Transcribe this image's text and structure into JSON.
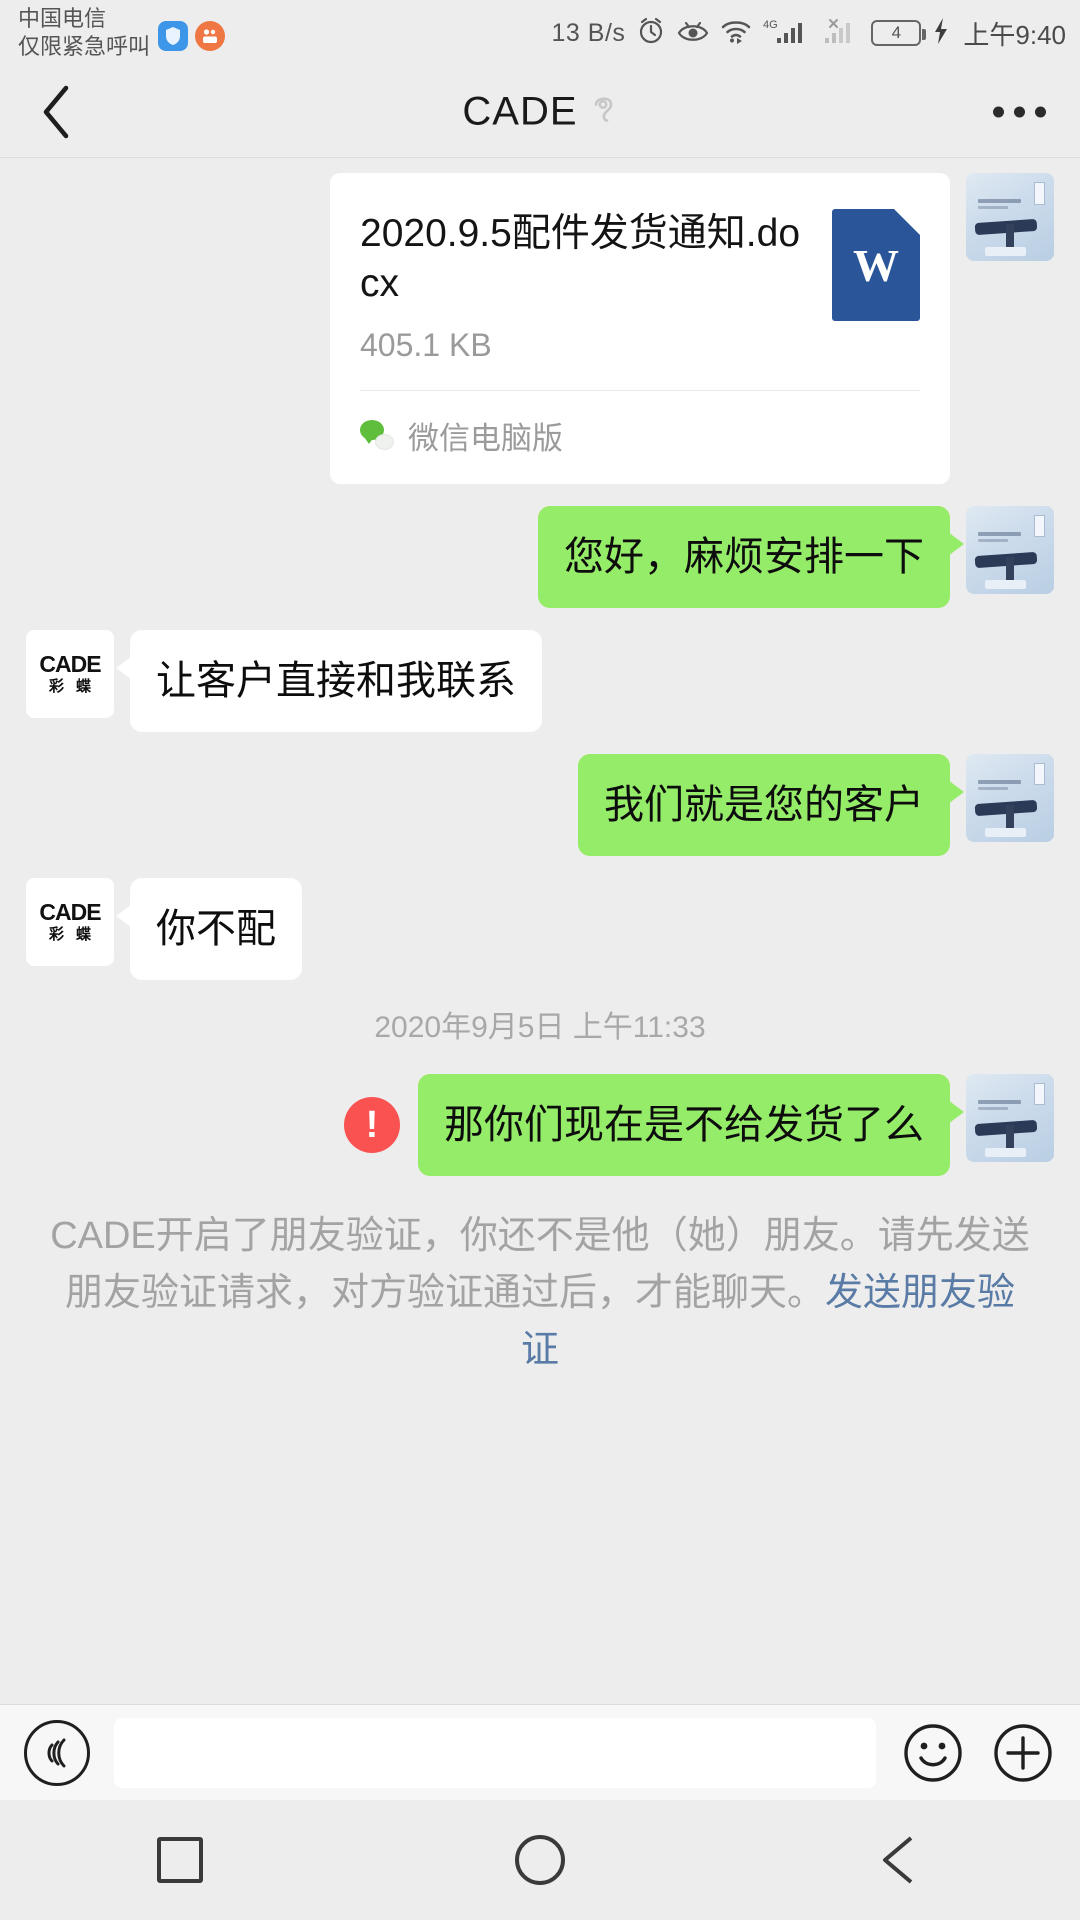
{
  "status_bar": {
    "carrier_line1": "中国电信",
    "carrier_line2": "仅限紧急呼叫",
    "network_speed": "13 B/s",
    "network_type": "4G",
    "battery_level": "4",
    "time": "上午9:40",
    "icons": [
      "shield-app-icon",
      "camera-app-icon",
      "alarm-icon",
      "eye-care-icon",
      "wifi-icon",
      "signal-4g-icon",
      "signal-no-sim-icon",
      "battery-icon",
      "charging-bolt-icon"
    ]
  },
  "nav_bar": {
    "back_icon": "chevron-left-icon",
    "title": "CADE",
    "mute_icon": "mute-ear-icon",
    "more_icon": "more-dots-icon"
  },
  "messages": [
    {
      "id": "msg-file",
      "type": "file",
      "side": "out",
      "file_name": "2020.9.5配件发货通知.docx",
      "file_size": "405.1 KB",
      "file_type_letter": "W",
      "source_app": "微信电脑版",
      "avatar": "user-product-avatar"
    },
    {
      "id": "msg-1",
      "type": "text",
      "side": "out",
      "text": "您好，麻烦安排一下",
      "avatar": "user-product-avatar"
    },
    {
      "id": "msg-2",
      "type": "text",
      "side": "in",
      "text": "让客户直接和我联系",
      "avatar": "cade-logo-avatar"
    },
    {
      "id": "msg-3",
      "type": "text",
      "side": "out",
      "text": "我们就是您的客户",
      "avatar": "user-product-avatar"
    },
    {
      "id": "msg-4",
      "type": "text",
      "side": "in",
      "text": "你不配",
      "avatar": "cade-logo-avatar"
    }
  ],
  "time_divider": "2020年9月5日 上午11:33",
  "failed_message": {
    "id": "msg-5",
    "type": "text",
    "side": "out",
    "text": "那你们现在是不给发货了么",
    "error_mark": "!",
    "avatar": "user-product-avatar"
  },
  "system_notice": {
    "text_before": "CADE开启了朋友验证，你还不是他（她）朋友。请先发送朋友验证请求，对方验证通过后，才能聊天。",
    "link_text": "发送朋友验证"
  },
  "input_bar": {
    "voice_icon": "voice-wave-icon",
    "input_value": "",
    "input_placeholder": "",
    "emoji_icon": "emoji-smile-icon",
    "more_icon": "plus-circle-icon"
  },
  "nav_keys": {
    "recents_label": "recents-square-key",
    "home_label": "home-circle-key",
    "back_label": "back-triangle-key"
  },
  "avatars": {
    "cade": {
      "line1": "CADE",
      "line2": "彩蝶"
    }
  },
  "colors": {
    "bubble_sent": "#95ec69",
    "bubble_received": "#ffffff",
    "background": "#ededed",
    "error_red": "#fa5151",
    "word_blue": "#2a5699",
    "link_blue": "#5a7ba6"
  }
}
